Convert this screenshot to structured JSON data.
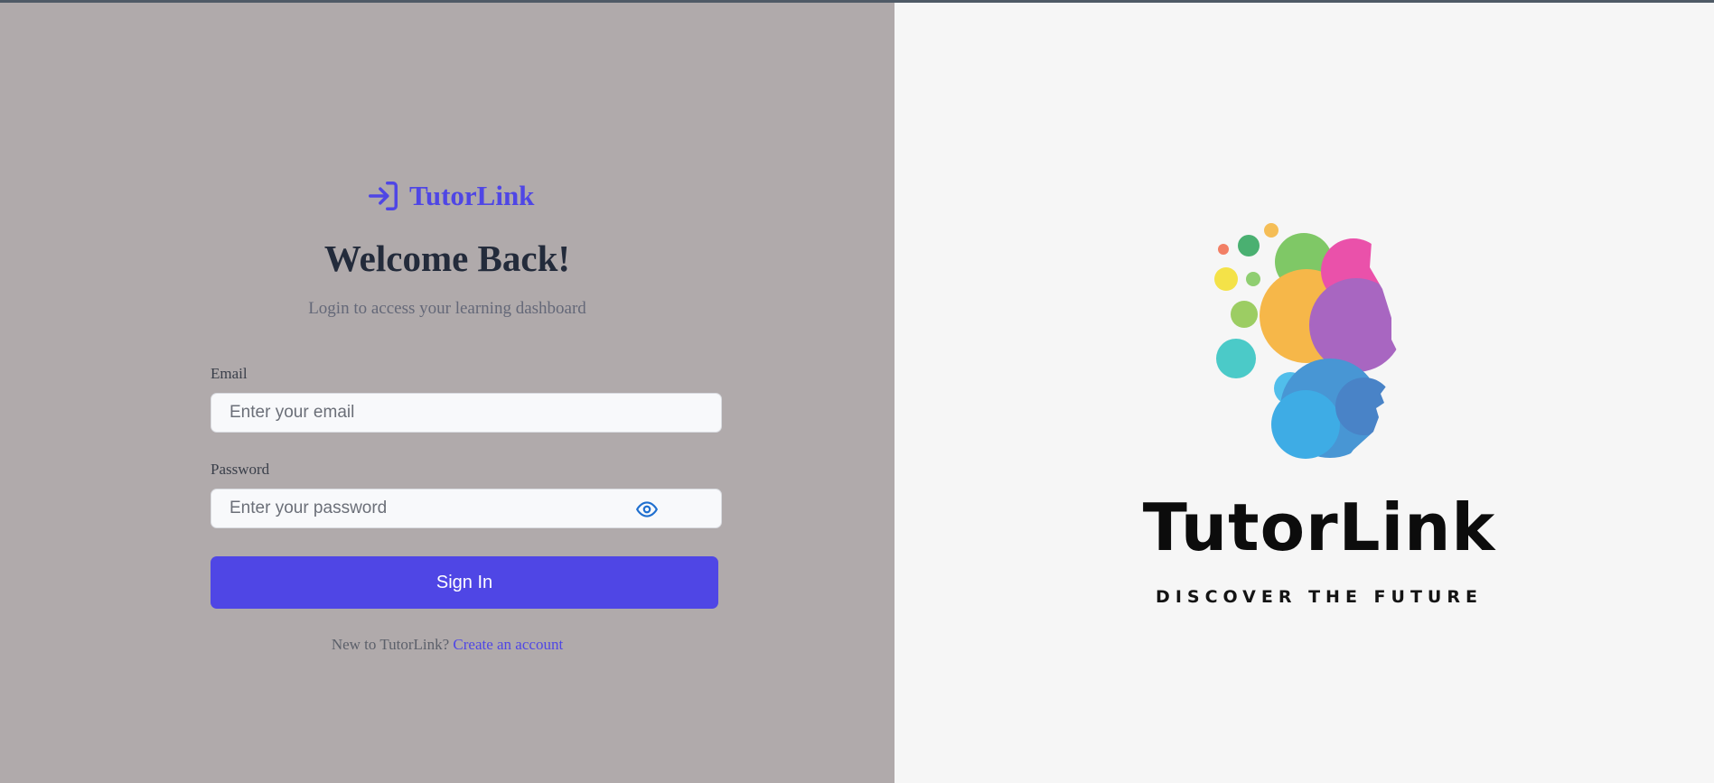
{
  "brand": {
    "name": "TutorLink",
    "color": "#4f46e5"
  },
  "login": {
    "heading": "Welcome Back!",
    "subtitle": "Login to access your learning dashboard",
    "email_label": "Email",
    "email_placeholder": "Enter your email",
    "password_label": "Password",
    "password_placeholder": "Enter your password",
    "sign_in_label": "Sign In",
    "footer_prompt": "New to TutorLink?",
    "create_account_label": "Create an account"
  },
  "logo_panel": {
    "wordmark": "TutorLink",
    "tagline": "DISCOVER THE FUTURE",
    "graphic": "colorful-head-icon"
  },
  "colors": {
    "accent": "#4f46e5",
    "left_background": "#b0aaab",
    "right_background": "#f6f6f6",
    "heading_text": "#232b3b"
  },
  "icons": {
    "brand_icon": "login-arrow-icon",
    "password_toggle_icon": "eye-icon"
  }
}
